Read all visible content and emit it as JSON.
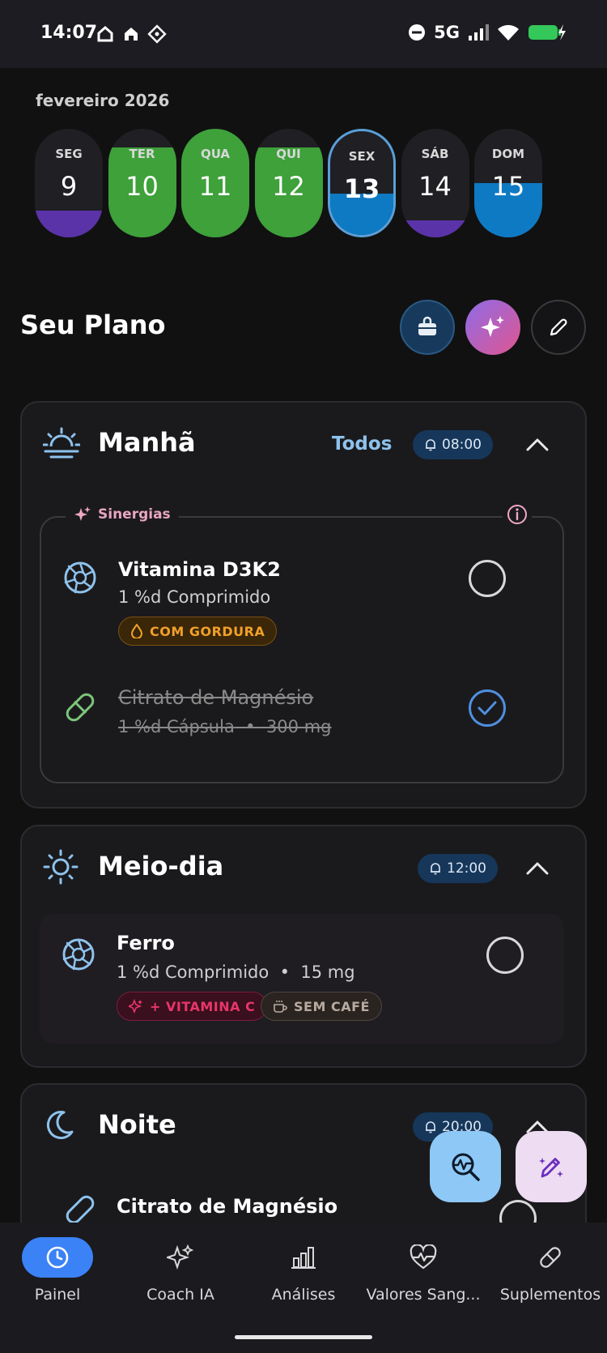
{
  "status": {
    "time": "14:07",
    "network": "5G",
    "icons_left": [
      "home-icon",
      "home-alt-icon",
      "nfc-icon"
    ],
    "icons_right": [
      "do-not-disturb-icon",
      "signal-icon",
      "wifi-icon",
      "battery-charging-icon"
    ]
  },
  "calendar": {
    "month": "fevereiro 2026",
    "days": [
      {
        "name": "SEG",
        "num": "9",
        "fill_color": "#5b33a8",
        "fill_fraction": 0.25,
        "selected": false
      },
      {
        "name": "TER",
        "num": "10",
        "fill_color": "#3ea13a",
        "fill_fraction": 0.83,
        "selected": false
      },
      {
        "name": "QUA",
        "num": "11",
        "fill_color": "#3ea13a",
        "fill_fraction": 1.0,
        "selected": false
      },
      {
        "name": "QUI",
        "num": "12",
        "fill_color": "#3ea13a",
        "fill_fraction": 0.83,
        "selected": false
      },
      {
        "name": "SEX",
        "num": "13",
        "fill_color": "#0f7ac4",
        "fill_fraction": 0.4,
        "selected": true
      },
      {
        "name": "SÁB",
        "num": "14",
        "fill_color": "#5b33a8",
        "fill_fraction": 0.16,
        "selected": false
      },
      {
        "name": "DOM",
        "num": "15",
        "fill_color": "#0f7ac4",
        "fill_fraction": 0.5,
        "selected": false
      }
    ]
  },
  "plan": {
    "title": "Seu Plano",
    "actions": [
      "bag-icon",
      "sparkles-icon",
      "pencil-icon"
    ]
  },
  "sections": {
    "morning": {
      "title": "Manhã",
      "todos": "Todos",
      "alarm": "08:00",
      "synergy_label": "Sinergias",
      "items": [
        {
          "name": "Vitamina D3K2",
          "dose": "1 %d Comprimido",
          "tag": "COM GORDURA",
          "done": false
        },
        {
          "name": "Citrato de Magnésio",
          "dose": "1 %d Cápsula",
          "amount": "300 mg",
          "done": true
        }
      ]
    },
    "midday": {
      "title": "Meio-dia",
      "alarm": "12:00",
      "items": [
        {
          "name": "Ferro",
          "dose": "1 %d Comprimido",
          "amount": "15 mg",
          "tags": [
            "+ VITAMINA C",
            "SEM CAFÉ"
          ],
          "done": false
        }
      ]
    },
    "night": {
      "title": "Noite",
      "alarm": "20:00",
      "items": [
        {
          "name": "Citrato de Magnésio",
          "done": false
        }
      ]
    }
  },
  "colors": {
    "accent_blue": "#3b82f6",
    "green": "#3ea13a",
    "purple": "#5b33a8",
    "blue": "#0f7ac4",
    "tag_orange": "#f0a02a",
    "tag_pink": "#e8366a"
  },
  "nav": [
    {
      "label": "Painel",
      "icon": "clock-icon",
      "active": true
    },
    {
      "label": "Coach IA",
      "icon": "sparkles-icon",
      "active": false
    },
    {
      "label": "Análises",
      "icon": "bar-chart-icon",
      "active": false
    },
    {
      "label": "Valores Sang...",
      "icon": "heart-pulse-icon",
      "active": false
    },
    {
      "label": "Suplementos",
      "icon": "pill-icon",
      "active": false
    }
  ]
}
